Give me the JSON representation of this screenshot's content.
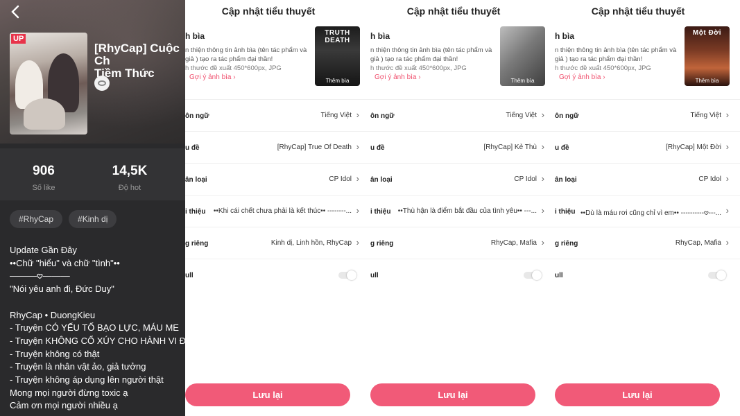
{
  "detail": {
    "cover_badge": "UP",
    "title": "[RhyCap] Cuộc Ch\nTiềm Thức",
    "stats": [
      {
        "value": "906",
        "label": "Số like"
      },
      {
        "value": "14,5K",
        "label": "Độ hot"
      }
    ],
    "tags": [
      "#RhyCap",
      "#Kinh dị"
    ],
    "description": "Update Gần Đây\n••Chữ \"hiểu\" và chữ \"tình\"••\n———𖹭———\n\"Nói yêu anh đi, Đức Duy\"\n\nRhyCap • DuongKieu\n- Truyện CÓ YẾU TỐ BẠO LỰC, MÁU ME\n- Truyện KHÔNG CỔ XÚY CHO HÀNH VI ĐI SA\n- Truyện không có thật\n- Truyện là nhân vật ảo, giả tưởng\n- Truyện không áp dụng lên người thật\nMong mọi người đừng toxic ạ\nCảm ơn mọi người nhiều ạ"
  },
  "panels": [
    {
      "title": "Cập nhật tiểu thuyết",
      "cover_label": "h bìa",
      "cover_hint_1": "n thiện thông tin ảnh bìa (tên tác phẩm và",
      "cover_hint_2": "giả ) tạo ra tác phẩm đại thần!",
      "cover_hint_3": "h thước đề xuất 450*600px, JPG",
      "suggest": "Gợi ý ảnh bìa ›",
      "thumb_title": "TRUTH DEATH",
      "thumb_add": "Thêm bìa",
      "rows": [
        {
          "key": "ôn ngữ",
          "value": "Tiếng Việt"
        },
        {
          "key": "u đề",
          "value": "[RhyCap] True Of Death"
        },
        {
          "key": "ân loại",
          "value": "CP Idol"
        },
        {
          "key": "i thiệu",
          "value": "••Khi cái chết chưa phải là kết thúc•• --------..."
        },
        {
          "key": "g riêng",
          "value": "Kinh dị, Linh hồn, RhyCap"
        }
      ],
      "toggle_label": "ull",
      "save": "Lưu lại"
    },
    {
      "title": "Cập nhật tiểu thuyết",
      "cover_label": "h bìa",
      "cover_hint_1": "n thiện thông tin ảnh bìa (tên tác phẩm và",
      "cover_hint_2": "giả ) tạo ra tác phẩm đại thần!",
      "cover_hint_3": "h thước đề xuất 450*600px, JPG",
      "suggest": "Gợi ý ảnh bìa ›",
      "thumb_title": "",
      "thumb_add": "Thêm bìa",
      "rows": [
        {
          "key": "ôn ngữ",
          "value": "Tiếng Việt"
        },
        {
          "key": "u đề",
          "value": "[RhyCap] Kẻ Thù"
        },
        {
          "key": "ân loại",
          "value": "CP Idol"
        },
        {
          "key": "i thiệu",
          "value": "••Thù hận là điểm bắt đầu của tình yêu•• ---..."
        },
        {
          "key": "g riêng",
          "value": "RhyCap, Mafia"
        }
      ],
      "toggle_label": "ull",
      "save": "Lưu lại"
    },
    {
      "title": "Cập nhật tiểu thuyết",
      "cover_label": "h bìa",
      "cover_hint_1": "n thiện thông tin ảnh bìa (tên tác phẩm và",
      "cover_hint_2": "giả ) tạo ra tác phẩm đại thần!",
      "cover_hint_3": "h thước đề xuất 450*600px, JPG",
      "suggest": "Gợi ý ảnh bìa ›",
      "thumb_title": "Một Đời",
      "thumb_add": "Thêm bìa",
      "rows": [
        {
          "key": "ôn ngữ",
          "value": "Tiếng Việt"
        },
        {
          "key": "u đề",
          "value": "[RhyCap] Một Đời"
        },
        {
          "key": "ân loại",
          "value": "CP Idol"
        },
        {
          "key": "i thiệu",
          "value": "••Dù là máu rơi cũng chỉ vì em•• ----------𖹭---..."
        },
        {
          "key": "g riêng",
          "value": "RhyCap, Mafia"
        }
      ],
      "toggle_label": "ull",
      "save": "Lưu lại"
    }
  ],
  "icons": {
    "back": "chevron-left-icon",
    "row_arrow": "chevron-right-icon",
    "suggest_arrow": "chevron-right-icon"
  },
  "colors": {
    "accent": "#f15a78",
    "detail_bg": "#2a2a2c"
  }
}
